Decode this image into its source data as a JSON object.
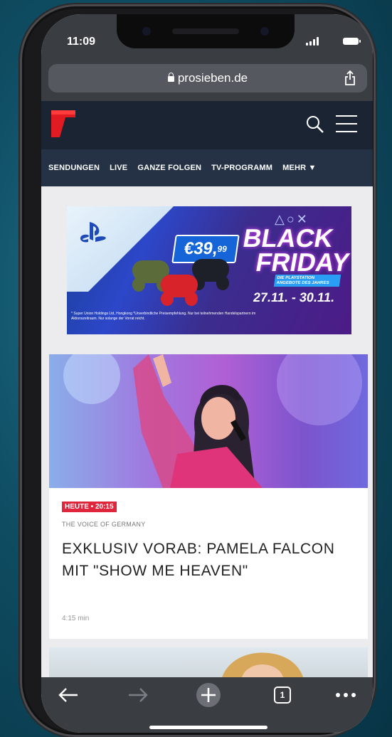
{
  "status_bar": {
    "time": "11:09"
  },
  "browser": {
    "url": "prosieben.de"
  },
  "site": {
    "nav_items": [
      "SENDUNGEN",
      "LIVE",
      "GANZE FOLGEN",
      "TV-PROGRAMM",
      "MEHR ▼"
    ]
  },
  "ad": {
    "price": "€39,",
    "price_cents": "99",
    "line1": "BLACK",
    "line2": "FRIDAY",
    "symbols": "△○✕",
    "subline": "DIE PLAYSTATION ANGEBOTE DES JAHRES",
    "dates": "27.11. - 30.11.",
    "footnote": "* Super Union Holdings Ltd, Hongkong *Unverbindliche Preisempfehlung. Nur bei teilnehmenden Handelspartnern im Aktionszeitraum. Nur solange der Vorrat reicht."
  },
  "article": {
    "badge": "HEUTE • 20:15",
    "kicker": "THE VOICE OF GERMANY",
    "headline": "EXKLUSIV VORAB: PAMELA FALCON MIT \"SHOW ME HEAVEN\"",
    "duration": "4:15 min"
  },
  "toolbar": {
    "tab_count": "1"
  },
  "colors": {
    "header_bg": "#1b2433",
    "nav_bg": "#253245",
    "badge_red": "#e0263d",
    "browser_chrome": "#3a3d42"
  }
}
